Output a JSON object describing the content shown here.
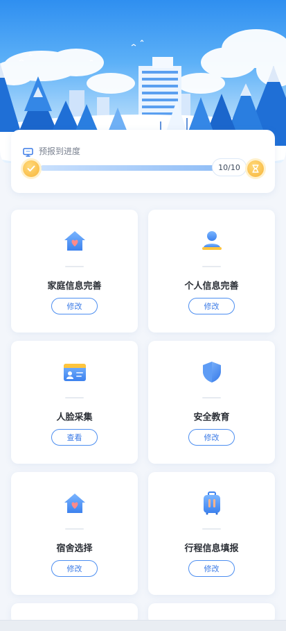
{
  "progress": {
    "title": "预报到进度",
    "count_label": "10/10",
    "completed": 10,
    "total": 10
  },
  "cards": [
    {
      "title": "家庭信息完善",
      "button_label": "修改",
      "icon": "house-heart-icon"
    },
    {
      "title": "个人信息完善",
      "button_label": "修改",
      "icon": "person-icon"
    },
    {
      "title": "人脸采集",
      "button_label": "查看",
      "icon": "id-card-icon"
    },
    {
      "title": "安全教育",
      "button_label": "修改",
      "icon": "shield-icon"
    },
    {
      "title": "宿舍选择",
      "button_label": "修改",
      "icon": "house-heart-icon"
    },
    {
      "title": "行程信息填报",
      "button_label": "修改",
      "icon": "luggage-icon"
    }
  ],
  "colors": {
    "accent": "#4b8df0",
    "progress_fill": "#8fbdf6",
    "badge_gold": "#f7b53a"
  }
}
